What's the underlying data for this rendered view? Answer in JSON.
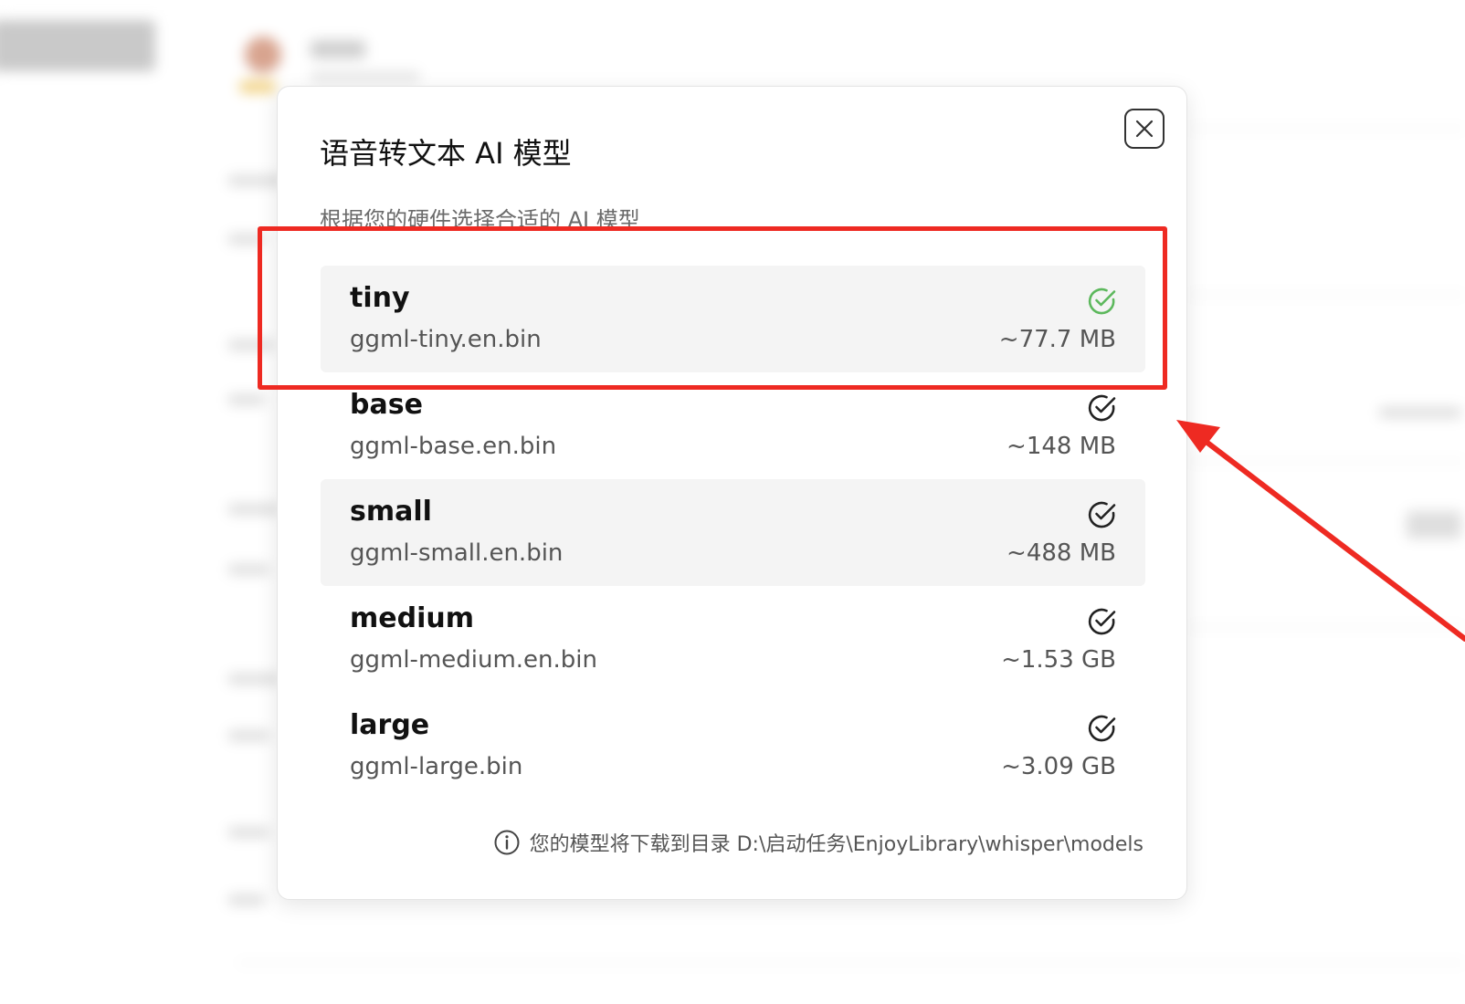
{
  "dialog": {
    "title": "语音转文本 AI 模型",
    "subtitle": "根据您的硬件选择合适的 AI 模型",
    "close_icon": "close-icon",
    "models": [
      {
        "name": "tiny",
        "file": "ggml-tiny.en.bin",
        "size": "~77.7 MB",
        "status": "selected",
        "check_color": "#5cb85c"
      },
      {
        "name": "base",
        "file": "ggml-base.en.bin",
        "size": "~148 MB",
        "status": "downloaded",
        "check_color": "#222222"
      },
      {
        "name": "small",
        "file": "ggml-small.en.bin",
        "size": "~488 MB",
        "status": "downloaded",
        "check_color": "#222222"
      },
      {
        "name": "medium",
        "file": "ggml-medium.en.bin",
        "size": "~1.53 GB",
        "status": "downloaded",
        "check_color": "#222222"
      },
      {
        "name": "large",
        "file": "ggml-large.bin",
        "size": "~3.09 GB",
        "status": "downloaded",
        "check_color": "#222222"
      }
    ],
    "footer": {
      "icon": "info-icon",
      "text": "您的模型将下载到目录 D:\\启动任务\\EnjoyLibrary\\whisper\\models"
    }
  },
  "annotation": {
    "color": "#ee2a22",
    "highlight": "red-rectangle",
    "arrow": "red-arrow"
  }
}
